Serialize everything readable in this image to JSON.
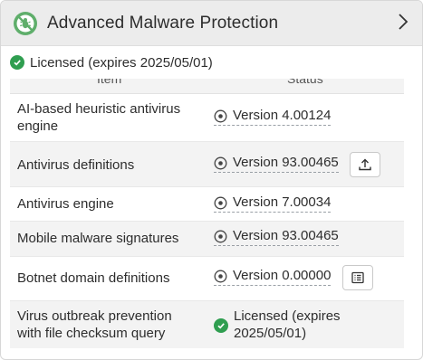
{
  "header": {
    "title": "Advanced Malware Protection",
    "logo_icon": "shield-bug-icon",
    "chevron_icon": "chevron-right-icon"
  },
  "license": {
    "text": "Licensed (expires 2025/05/01)",
    "status_color": "#2f9e50"
  },
  "table": {
    "columns": [
      "Item",
      "Status"
    ],
    "rows": [
      {
        "name": "AI-based heuristic antivirus engine",
        "status": "Version 4.00124",
        "action": ""
      },
      {
        "name": "Antivirus definitions",
        "status": "Version 93.00465",
        "action": "upload-icon"
      },
      {
        "name": "Antivirus engine",
        "status": "Version 7.00034",
        "action": ""
      },
      {
        "name": "Mobile malware signatures",
        "status": "Version 93.00465",
        "action": ""
      },
      {
        "name": "Botnet domain definitions",
        "status": "Version 0.00000",
        "action": "list-icon"
      },
      {
        "name": "Virus outbreak prevention with file checksum query",
        "status": "Licensed (expires 2025/05/01)",
        "action": ""
      }
    ]
  }
}
